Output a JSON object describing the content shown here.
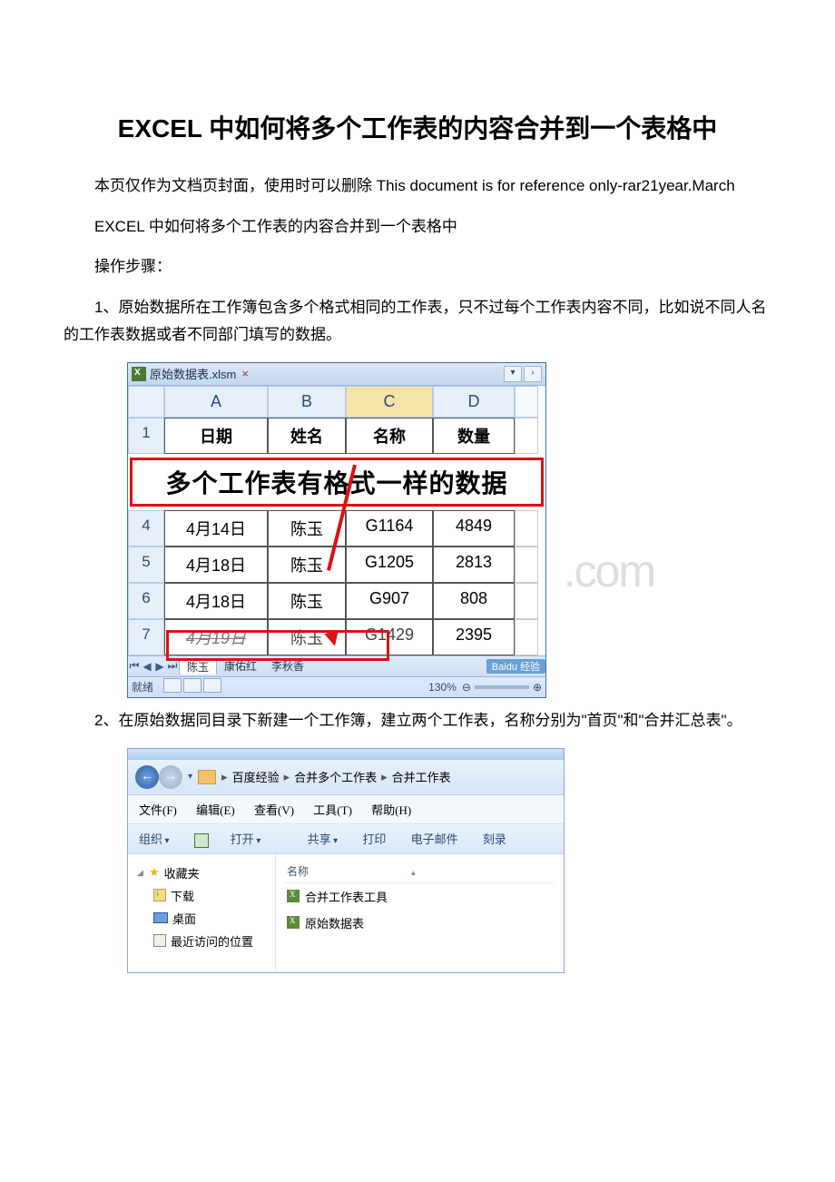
{
  "title": "EXCEL 中如何将多个工作表的内容合并到一个表格中",
  "disclaimer": "本页仅作为文档页封面，使用时可以删除 This document is for reference only-rar21year.March",
  "intro1": "EXCEL 中如何将多个工作表的内容合并到一个表格中",
  "intro2": "操作步骤：",
  "step1": "1、原始数据所在工作簿包含多个格式相同的工作表，只不过每个工作表内容不同，比如说不同人名的工作表数据或者不同部门填写的数据。",
  "step2": "2、在原始数据同目录下新建一个工作簿，建立两个工作表，名称分别为\"首页\"和\"合并汇总表\"。",
  "excel": {
    "tabTitle": "原始数据表.xlsm",
    "cols": [
      "A",
      "B",
      "C",
      "D"
    ],
    "headers": [
      "日期",
      "姓名",
      "名称",
      "数量"
    ],
    "banner": "多个工作表有格式一样的数据",
    "rows": [
      {
        "n": "4",
        "a": "4月14日",
        "b": "陈玉",
        "c": "G1164",
        "d": "4849"
      },
      {
        "n": "5",
        "a": "4月18日",
        "b": "陈玉",
        "c": "G1205",
        "d": "2813"
      },
      {
        "n": "6",
        "a": "4月18日",
        "b": "陈玉",
        "c": "G907",
        "d": "808"
      },
      {
        "n": "7",
        "a": "4月19日",
        "b": "陈玉",
        "c": "G1429",
        "d": "2395"
      }
    ],
    "sheetTabs": [
      "陈玉",
      "康佑红",
      "李秋香"
    ],
    "badge": "Baidu 经验",
    "status": "就绪",
    "zoom": "130%",
    "watermark": ".com"
  },
  "explorer": {
    "breadcrumbs": [
      "百度经验",
      "合并多个工作表",
      "合并工作表"
    ],
    "menus": [
      "文件(F)",
      "编辑(E)",
      "查看(V)",
      "工具(T)",
      "帮助(H)"
    ],
    "toolbar": {
      "organize": "组织",
      "open": "打开",
      "share": "共享",
      "print": "打印",
      "email": "电子邮件",
      "burn": "刻录"
    },
    "favorites": "收藏夹",
    "navItems": [
      "下载",
      "桌面",
      "最近访问的位置"
    ],
    "colName": "名称",
    "files": [
      "合并工作表工具",
      "原始数据表"
    ]
  }
}
